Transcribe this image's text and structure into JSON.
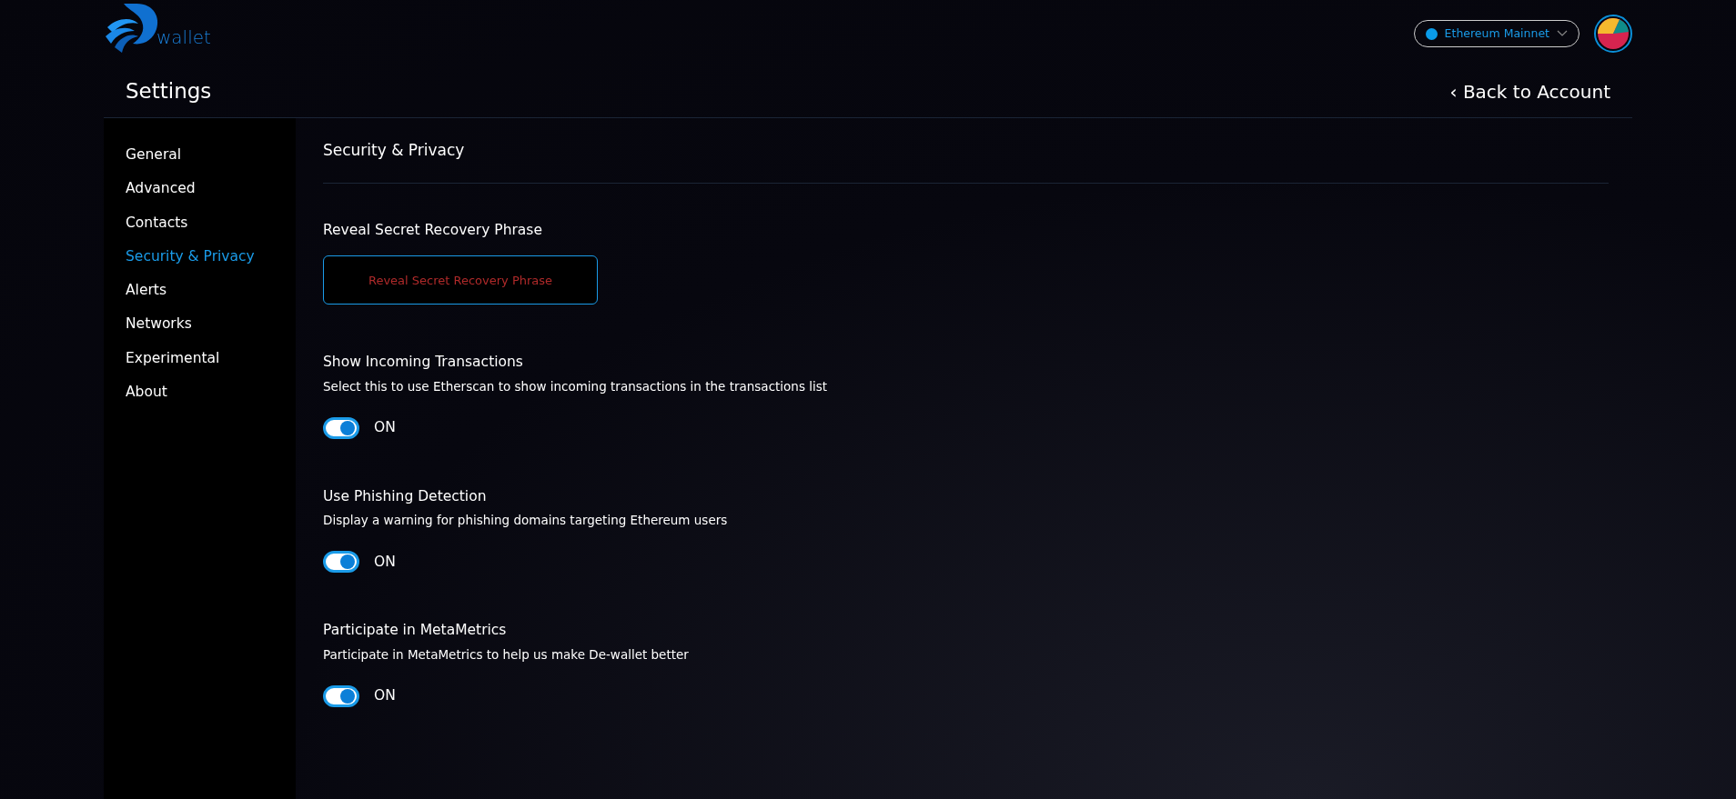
{
  "logo": {
    "text": "wallet"
  },
  "network": {
    "label": "Ethereum Mainnet",
    "color": "#0a9be8"
  },
  "page": {
    "title": "Settings",
    "back_link": "‹ Back to Account"
  },
  "sidebar": {
    "items": [
      {
        "label": "General",
        "selected": false
      },
      {
        "label": "Advanced",
        "selected": false
      },
      {
        "label": "Contacts",
        "selected": false
      },
      {
        "label": "Security & Privacy",
        "selected": true
      },
      {
        "label": "Alerts",
        "selected": false
      },
      {
        "label": "Networks",
        "selected": false
      },
      {
        "label": "Experimental",
        "selected": false
      },
      {
        "label": "About",
        "selected": false
      }
    ]
  },
  "content": {
    "title": "Security & Privacy",
    "reveal": {
      "label": "Reveal Secret Recovery Phrase",
      "button": "Reveal Secret Recovery Phrase"
    },
    "settings": [
      {
        "title": "Show Incoming Transactions",
        "description": "Select this to use Etherscan to show incoming transactions in the transactions list",
        "on": true,
        "state_label": "ON"
      },
      {
        "title": "Use Phishing Detection",
        "description": "Display a warning for phishing domains targeting Ethereum users",
        "on": true,
        "state_label": "ON"
      },
      {
        "title": "Participate in MetaMetrics",
        "description": "Participate in MetaMetrics to help us make De-wallet better",
        "on": true,
        "state_label": "ON"
      }
    ]
  }
}
